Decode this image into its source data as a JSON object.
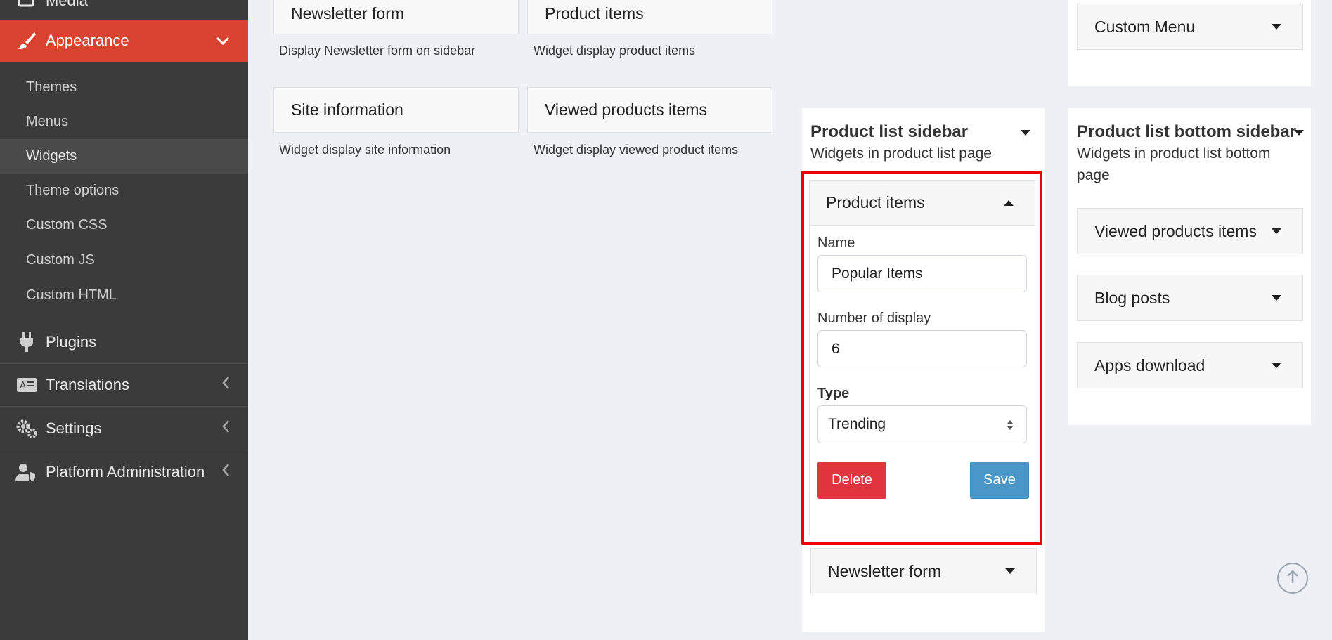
{
  "sidebar": {
    "media_label": "Media",
    "appearance_label": "Appearance",
    "appearance_sub": [
      "Themes",
      "Menus",
      "Widgets",
      "Theme options",
      "Custom CSS",
      "Custom JS",
      "Custom HTML"
    ],
    "plugins_label": "Plugins",
    "translations_label": "Translations",
    "settings_label": "Settings",
    "platform_label": "Platform Administration"
  },
  "available_widgets": [
    {
      "name": "Newsletter form",
      "desc": "Display Newsletter form on sidebar"
    },
    {
      "name": "Product items",
      "desc": "Widget display product items"
    },
    {
      "name": "Site information",
      "desc": "Widget display site information"
    },
    {
      "name": "Viewed products items",
      "desc": "Widget display viewed product items"
    }
  ],
  "top_right_panel": {
    "item": "Custom Menu"
  },
  "product_list_sidebar": {
    "title": "Product list sidebar",
    "subtitle": "Widgets in product list page",
    "open_widget": {
      "title": "Product items",
      "name_label": "Name",
      "name_value": "Popular Items",
      "number_label": "Number of display",
      "number_value": "6",
      "type_label": "Type",
      "type_value": "Trending",
      "delete_label": "Delete",
      "save_label": "Save"
    },
    "other_item": "Newsletter form"
  },
  "product_list_bottom_sidebar": {
    "title": "Product list bottom sidebar",
    "subtitle": "Widgets in product list bottom page",
    "items": [
      "Viewed products items",
      "Blog posts",
      "Apps download"
    ]
  },
  "colors": {
    "sidebar_bg": "#3b3b3b",
    "accent": "#d9432f",
    "delete": "#e0343f",
    "save": "#4a97c7",
    "highlight": "#ee0000"
  }
}
